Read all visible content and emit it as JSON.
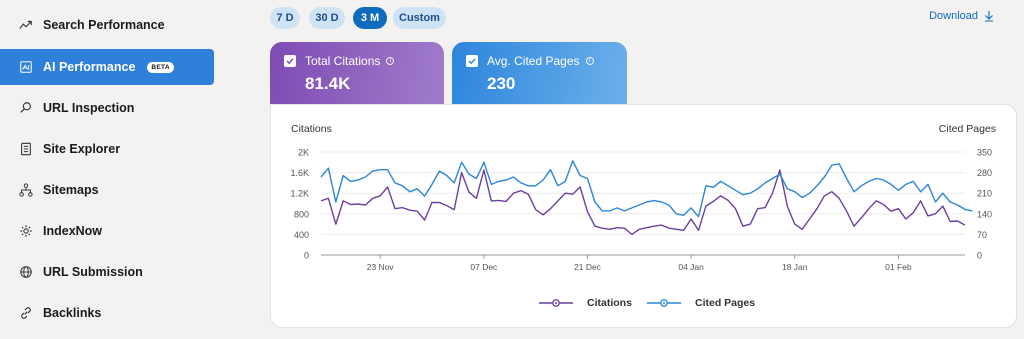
{
  "sidebar": {
    "items": [
      {
        "label": "Search Performance",
        "icon": "trend-icon",
        "active": false
      },
      {
        "label": "AI Performance",
        "icon": "ai-icon",
        "active": true,
        "badge": "BETA"
      },
      {
        "label": "URL Inspection",
        "icon": "search-icon",
        "active": false
      },
      {
        "label": "Site Explorer",
        "icon": "document-icon",
        "active": false
      },
      {
        "label": "Sitemaps",
        "icon": "sitemap-icon",
        "active": false
      },
      {
        "label": "IndexNow",
        "icon": "gear-icon",
        "active": false
      },
      {
        "label": "URL Submission",
        "icon": "globe-icon",
        "active": false
      },
      {
        "label": "Backlinks",
        "icon": "link-icon",
        "active": false
      }
    ]
  },
  "ranges": [
    {
      "label": "7 D",
      "active": false
    },
    {
      "label": "30 D",
      "active": false
    },
    {
      "label": "3 M",
      "active": true
    },
    {
      "label": "Custom",
      "active": false
    }
  ],
  "download_label": "Download",
  "cards": {
    "citations": {
      "title": "Total Citations",
      "value": "81.4K",
      "color": "#7e4bb3"
    },
    "pages": {
      "title": "Avg. Cited Pages",
      "value": "230",
      "color": "#2d85dc"
    }
  },
  "chart_data": {
    "type": "line",
    "ylabel_left": "Citations",
    "ylabel_right": "Cited Pages",
    "y_left_ticks": [
      "2K",
      "1.6K",
      "1.2K",
      "800",
      "400",
      "0"
    ],
    "y_right_ticks": [
      "350",
      "280",
      "210",
      "140",
      "70",
      "0"
    ],
    "ylim_left": [
      0,
      2000
    ],
    "ylim_right": [
      0,
      350
    ],
    "x_ticks": [
      "23 Nov",
      "07 Dec",
      "21 Dec",
      "04 Jan",
      "18 Jan",
      "01 Feb"
    ],
    "x_tick_index": [
      8,
      22,
      36,
      50,
      64,
      78
    ],
    "grid": true,
    "legend_position": "bottom",
    "series": [
      {
        "name": "Citations",
        "color": "#6b3fa0",
        "axis": "left",
        "values": [
          1050,
          1100,
          600,
          1050,
          980,
          990,
          970,
          1100,
          1150,
          1320,
          900,
          920,
          870,
          850,
          680,
          1020,
          1020,
          960,
          880,
          1600,
          1220,
          1100,
          1650,
          1050,
          1060,
          1040,
          1200,
          1250,
          1180,
          880,
          780,
          900,
          1050,
          1200,
          1180,
          1320,
          840,
          560,
          520,
          500,
          530,
          520,
          400,
          500,
          530,
          560,
          580,
          520,
          500,
          480,
          700,
          480,
          950,
          1040,
          1150,
          1060,
          900,
          560,
          600,
          900,
          920,
          1200,
          1650,
          950,
          600,
          500,
          700,
          900,
          1150,
          1230,
          1100,
          850,
          560,
          720,
          900,
          1050,
          980,
          850,
          900,
          700,
          820,
          1050,
          760,
          800,
          950,
          650,
          660,
          580
        ]
      },
      {
        "name": "Cited Pages",
        "color": "#2b86d8",
        "axis": "right",
        "values": [
          265,
          295,
          180,
          270,
          250,
          255,
          265,
          285,
          290,
          290,
          245,
          235,
          215,
          225,
          200,
          240,
          285,
          270,
          245,
          315,
          275,
          260,
          315,
          240,
          250,
          255,
          265,
          245,
          235,
          235,
          255,
          290,
          235,
          250,
          320,
          270,
          260,
          180,
          150,
          150,
          160,
          150,
          160,
          170,
          180,
          185,
          180,
          170,
          140,
          135,
          160,
          130,
          235,
          230,
          250,
          235,
          220,
          205,
          210,
          225,
          245,
          260,
          275,
          225,
          215,
          195,
          210,
          235,
          265,
          305,
          310,
          260,
          215,
          235,
          250,
          260,
          255,
          240,
          220,
          240,
          250,
          215,
          240,
          180,
          210,
          180,
          170,
          155,
          150
        ]
      }
    ]
  }
}
